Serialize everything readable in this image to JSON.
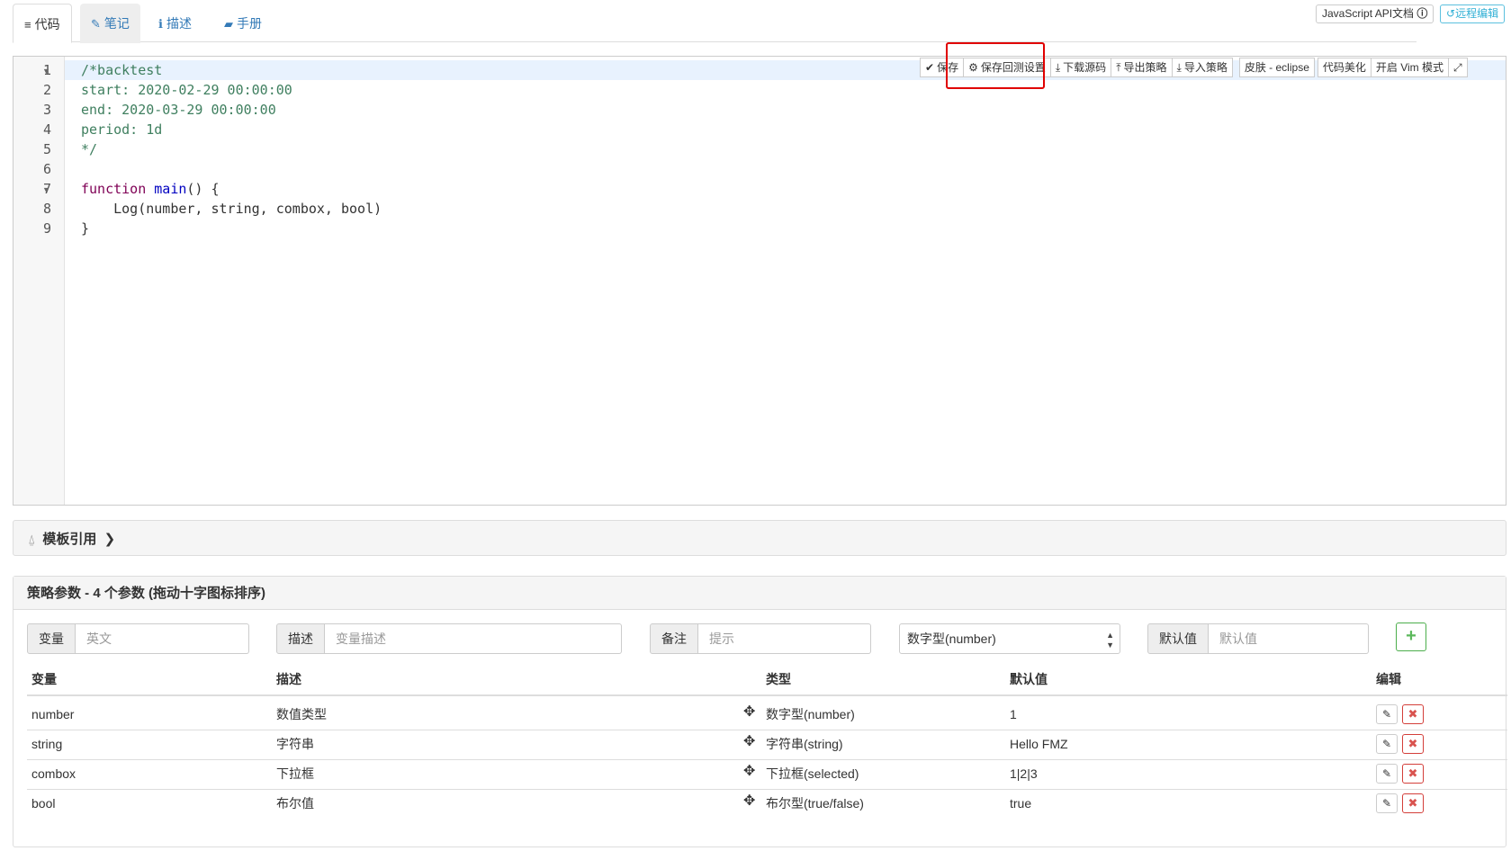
{
  "tabs": [
    {
      "icon": "list-icon",
      "glyph": "≡",
      "label": "代码"
    },
    {
      "icon": "edit-icon",
      "glyph": "✎",
      "label": "笔记"
    },
    {
      "icon": "info-circle-icon",
      "glyph": "ℹ",
      "label": "描述"
    },
    {
      "icon": "book-icon",
      "glyph": "▰",
      "label": "手册"
    }
  ],
  "top_right": {
    "api_doc_label": "JavaScript API文档",
    "remote_edit_label": "远程编辑"
  },
  "toolbar": {
    "save": "保存",
    "save_backtest": "保存回测设置",
    "download": "下载源码",
    "export": "导出策略",
    "import": "导入策略",
    "skin": "皮肤 - eclipse",
    "beautify": "代码美化",
    "vim": "开启 Vim 模式"
  },
  "code": {
    "line_numbers": [
      "1",
      "2",
      "3",
      "4",
      "5",
      "6",
      "7",
      "8",
      "9"
    ],
    "line1": "/*backtest",
    "line2": "start: 2020-02-29 00:00:00",
    "line3": "end: 2020-03-29 00:00:00",
    "line4": "period: 1d",
    "line5": "*/",
    "line7_kw": "function",
    "line7_fn": "main",
    "line7_rest": "() {",
    "line8": "    Log(number, string, combox, bool)",
    "line9": "}"
  },
  "template_panel": {
    "title": "模板引用"
  },
  "params_panel": {
    "title": "策略参数 - 4 个参数 (拖动十字图标排序)",
    "form": {
      "var_label": "变量",
      "var_placeholder": "英文",
      "desc_label": "描述",
      "desc_placeholder": "变量描述",
      "note_label": "备注",
      "note_placeholder": "提示",
      "type_selected": "数字型(number)",
      "default_label": "默认值",
      "default_placeholder": "默认值"
    },
    "columns": [
      "变量",
      "描述",
      "类型",
      "默认值",
      "编辑"
    ],
    "rows": [
      {
        "var": "number",
        "desc": "数值类型",
        "type": "数字型(number)",
        "default": "1"
      },
      {
        "var": "string",
        "desc": "字符串",
        "type": "字符串(string)",
        "default": "Hello FMZ"
      },
      {
        "var": "combox",
        "desc": "下拉框",
        "type": "下拉框(selected)",
        "default": "1|2|3"
      },
      {
        "var": "bool",
        "desc": "布尔值",
        "type": "布尔型(true/false)",
        "default": "true"
      }
    ]
  }
}
